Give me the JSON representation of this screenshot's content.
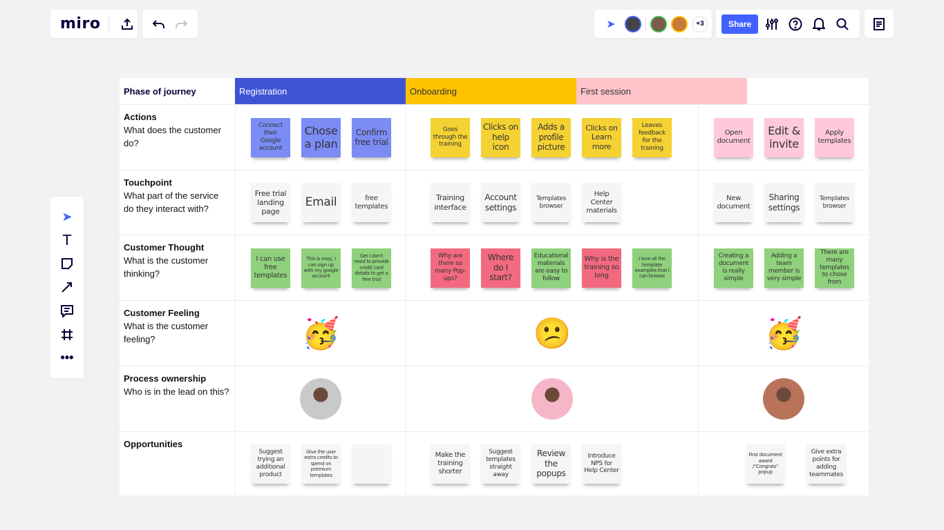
{
  "topbar": {
    "logo": "miro",
    "share_label": "Share",
    "more_count": "+3"
  },
  "colors": {
    "accent": "#4262ff",
    "registration": "#4053d6",
    "onboarding": "#fec300",
    "first_session": "#ffc4c9",
    "blue": "#7b8cf5",
    "yellow": "#f5d233",
    "pink": "#ffc9da",
    "white": "#f4f5f7",
    "green": "#8fd17c",
    "red": "#f36a80"
  },
  "board": {
    "corner": "Phase of journey",
    "phases": [
      "Registration",
      "Onboarding",
      "First session"
    ],
    "rows": [
      {
        "title": "Actions",
        "subtitle": "What does the customer do?",
        "cells": [
          [
            {
              "t": "Connect their Google account",
              "c": "blue",
              "s": 9
            },
            {
              "t": "Chose a plan",
              "c": "blue",
              "s": 16
            },
            {
              "t": "Confirm free trial",
              "c": "blue",
              "s": 12
            }
          ],
          [
            {
              "t": "Goes through the training",
              "c": "yellow",
              "s": 9
            },
            {
              "t": "Clicks on help icon",
              "c": "yellow",
              "s": 12
            },
            {
              "t": "Adds a profile picture",
              "c": "yellow",
              "s": 12
            },
            {
              "t": "Clicks on Learn more",
              "c": "yellow",
              "s": 11
            },
            {
              "t": "Leaves feedback for the training",
              "c": "yellow",
              "s": 9
            }
          ],
          [
            {
              "t": "Open document",
              "c": "pink",
              "s": 10
            },
            {
              "t": "Edit & invite",
              "c": "pink",
              "s": 16
            },
            {
              "t": "Apply templates",
              "c": "pink",
              "s": 10
            }
          ]
        ]
      },
      {
        "title": "Touchpoint",
        "subtitle": "What part of the service do they interact with?",
        "cells": [
          [
            {
              "t": "Free trial landing page",
              "c": "white",
              "s": 11
            },
            {
              "t": "Email",
              "c": "white",
              "s": 17
            },
            {
              "t": "free templates",
              "c": "white",
              "s": 10
            }
          ],
          [
            {
              "t": "Training interface",
              "c": "white",
              "s": 11
            },
            {
              "t": "Account settings",
              "c": "white",
              "s": 12
            },
            {
              "t": "Templates browser",
              "c": "white",
              "s": 9
            },
            {
              "t": "Help Center materials",
              "c": "white",
              "s": 10
            }
          ],
          [
            {
              "t": "New document",
              "c": "white",
              "s": 10
            },
            {
              "t": "Sharing settings",
              "c": "white",
              "s": 12
            },
            {
              "t": "Templates browser",
              "c": "white",
              "s": 9
            }
          ]
        ]
      },
      {
        "title": "Customer Thought",
        "subtitle": "What is the customer thinking?",
        "cells": [
          [
            {
              "t": "I can use free templates",
              "c": "green",
              "s": 10
            },
            {
              "t": "This is easy, I can sign up with my google account",
              "c": "green",
              "s": 7
            },
            {
              "t": "Get I don't need to provide credit card details to get a free trial",
              "c": "green",
              "s": 7
            }
          ],
          [
            {
              "t": "Why are there so many Pop-ups?",
              "c": "red",
              "s": 9
            },
            {
              "t": "Where do I start?",
              "c": "red",
              "s": 12
            },
            {
              "t": "Educational materials are easy to follow",
              "c": "green",
              "s": 9
            },
            {
              "t": "Why is the training so long",
              "c": "red",
              "s": 10
            },
            {
              "t": "I love all the template examples that I can browse",
              "c": "green",
              "s": 7
            }
          ],
          [
            {
              "t": "Creating a document is really simple",
              "c": "green",
              "s": 9
            },
            {
              "t": "Adding a team member is very simple",
              "c": "green",
              "s": 9
            },
            {
              "t": "There are many templates to chose from",
              "c": "green",
              "s": 9
            }
          ]
        ]
      },
      {
        "title": "Customer Feeling",
        "subtitle": "What is the customer feeling?",
        "emojis": [
          "🥳",
          "😕",
          "🥳"
        ]
      },
      {
        "title": "Process ownership",
        "subtitle": "Who is in the lead on this?",
        "avatars": [
          "#c9c9c9",
          "#f5b6c8",
          "#b9735a"
        ]
      },
      {
        "title": "Opportunities",
        "subtitle": "",
        "cells": [
          [
            {
              "t": "Suggest trying an additional product",
              "c": "white",
              "s": 9
            },
            {
              "t": "Give the user extra credits to spend on premium templates",
              "c": "white",
              "s": 7
            },
            {
              "t": "",
              "c": "white",
              "s": 9
            }
          ],
          [
            {
              "t": "Make the training shorter",
              "c": "white",
              "s": 10
            },
            {
              "t": "Suggest templates straight away",
              "c": "white",
              "s": 9
            },
            {
              "t": "Review the popups",
              "c": "white",
              "s": 12
            },
            {
              "t": "Introduce NPS for Help Center",
              "c": "white",
              "s": 9
            }
          ],
          [
            {
              "t": "First document award /\"Congrats\" popup",
              "c": "white",
              "s": 7
            },
            {
              "t": "Give extra points for adding teammates",
              "c": "white",
              "s": 9
            }
          ]
        ]
      }
    ]
  }
}
